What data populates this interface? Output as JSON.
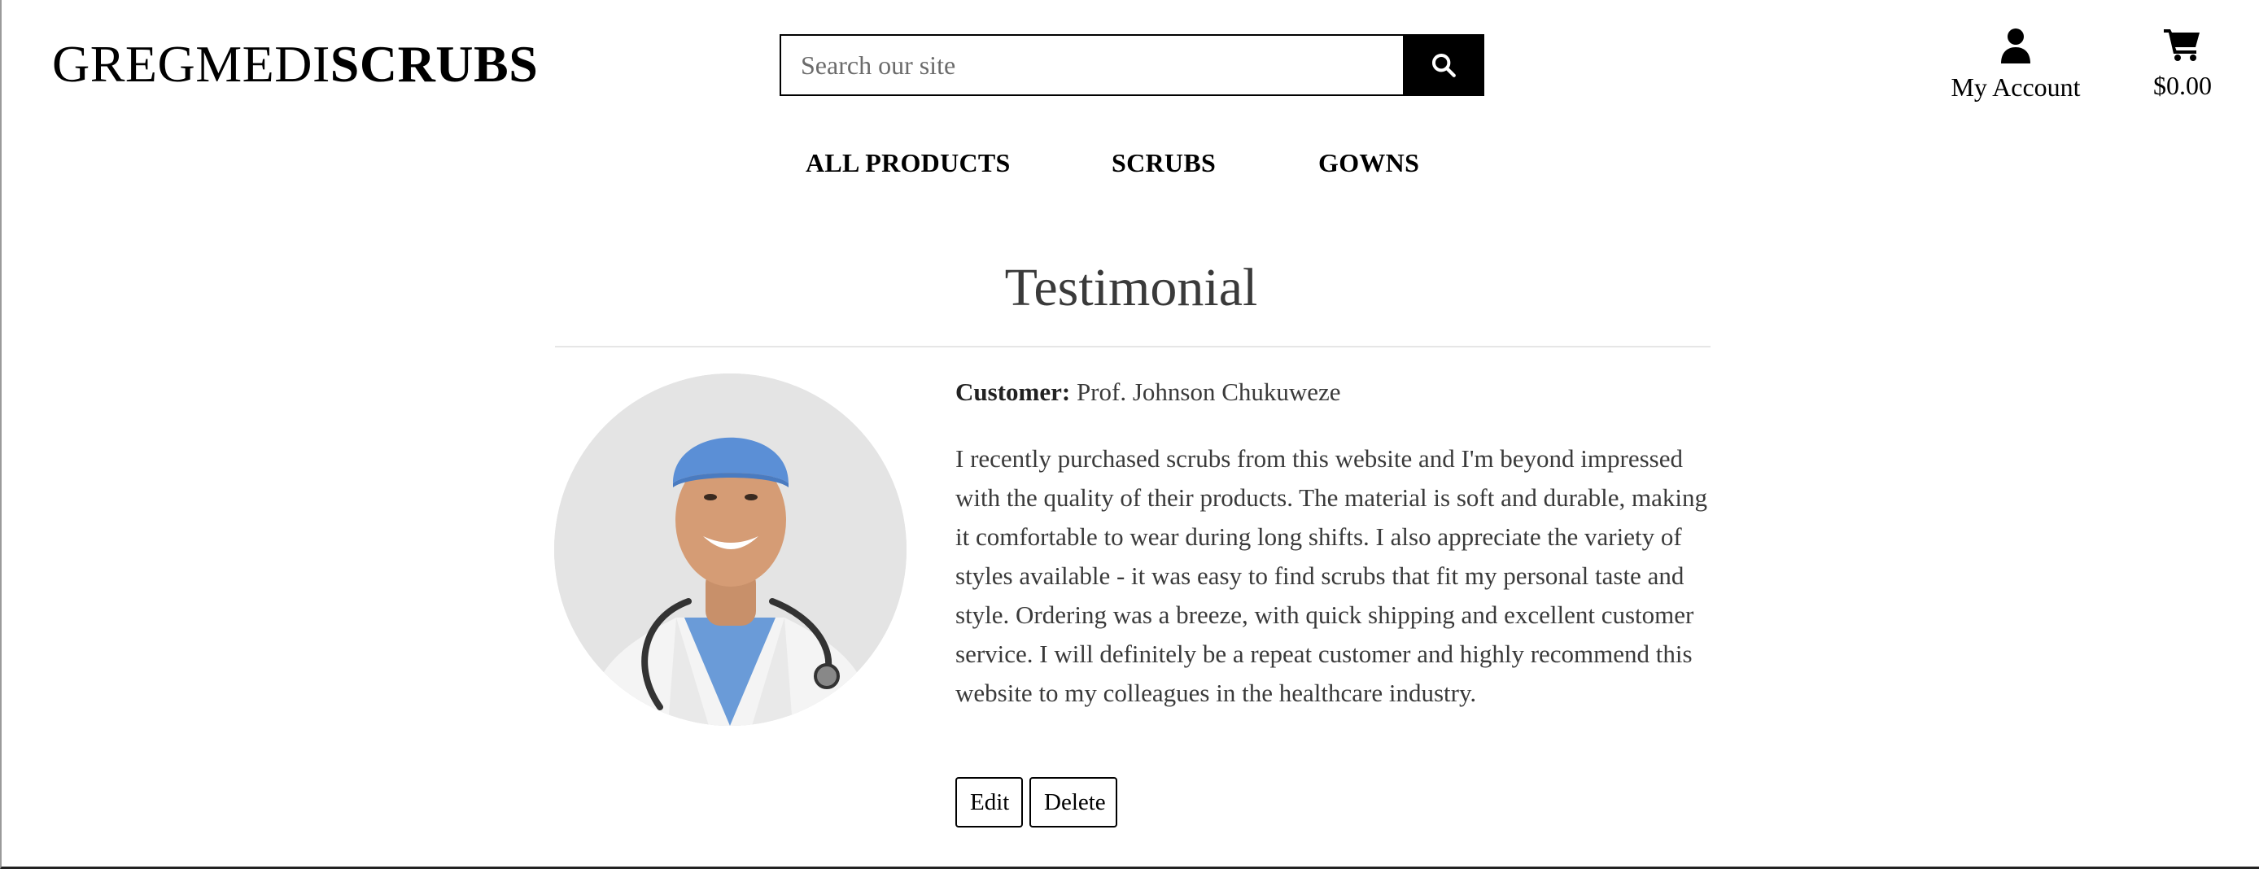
{
  "header": {
    "brand_light": "GREGMEDI",
    "brand_bold": "SCRUBS",
    "search": {
      "placeholder": "Search our site",
      "value": ""
    },
    "search_icon": "magnifier-icon",
    "account": {
      "icon": "user-icon",
      "label": "My Account"
    },
    "cart": {
      "icon": "cart-icon",
      "total": "$0.00"
    }
  },
  "nav": {
    "items": [
      {
        "label": "ALL PRODUCTS"
      },
      {
        "label": "SCRUBS"
      },
      {
        "label": "GOWNS"
      }
    ]
  },
  "testimonial": {
    "heading": "Testimonial",
    "customer_label": "Customer:",
    "customer_name": "Prof. Johnson Chukuweze",
    "text": "I recently purchased scrubs from this website and I'm beyond impressed with the quality of their products. The material is soft and durable, making it comfortable to wear during long shifts. I also appreciate the variety of styles available - it was easy to find scrubs that fit my personal taste and style. Ordering was a breeze, with quick shipping and excellent customer service. I will definitely be a repeat customer and highly recommend this website to my colleagues in the healthcare industry.",
    "buttons": {
      "edit": "Edit",
      "delete": "Delete"
    }
  },
  "colors": {
    "text_dark": "#3a3a3a",
    "scrub_blue": "#5b8fd6",
    "search_button": "#000000"
  }
}
